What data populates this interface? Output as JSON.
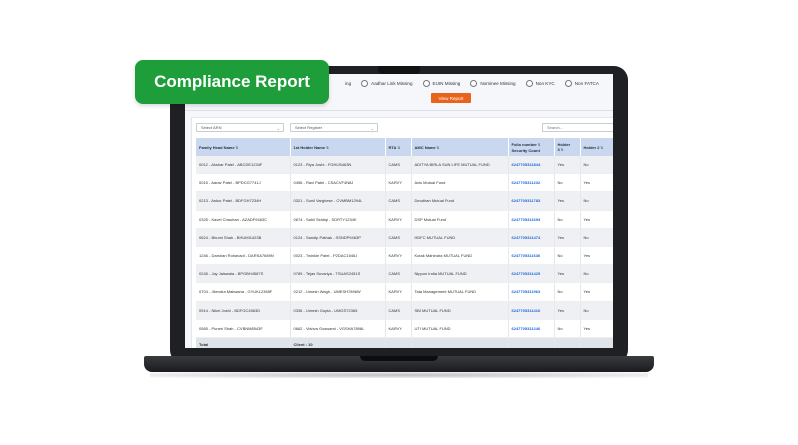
{
  "badge": {
    "label": "Compliance Report"
  },
  "filters": [
    {
      "label": "ing"
    },
    {
      "label": "Aadhar Link Missing"
    },
    {
      "label": "EUIN Missing"
    },
    {
      "label": "Nominee Missing"
    },
    {
      "label": "Non KYC"
    },
    {
      "label": "Non FATCA"
    }
  ],
  "view_button": {
    "label": "View Report"
  },
  "controls": {
    "arn_select": "Select ARN",
    "register_select": "Select Register",
    "search_placeholder": "Search..."
  },
  "table": {
    "headers": {
      "family_head": "Family Head Name",
      "first_holder": "1st Holder Name",
      "rta": "RTA",
      "amc": "AMC Name",
      "folio": "Folio number",
      "folio_sub": "Security Count",
      "holder3": "Holder 3",
      "holder2": "Holder 2"
    },
    "rows": [
      {
        "family_head": "0012 - Akshar Patel - ABCDE1234F",
        "first_holder": "0123 - Riya Joshi - FGHIJ5463N",
        "rta": "CAMS",
        "amc": "ADITYA BIRLA SUN LIFE MUTUAL FUND",
        "folio": "6247705311844",
        "h3": "Yes",
        "h2": "No"
      },
      {
        "family_head": "0015 - Aarav Patel - BPDCG7741J",
        "first_holder": "0456 - Ravi Patel - CSACVF4N8J",
        "rta": "KARVY",
        "amc": "Axis Mutual Fund",
        "folio": "6247705311232",
        "h3": "No",
        "h2": "Yes"
      },
      {
        "family_head": "0213 - Ankur Patel - BDFGH7234H",
        "first_holder": "0321 - Sunil Varghese - CVMBM1294L",
        "rta": "CAMS",
        "amc": "Deodhan Mutual Fund",
        "folio": "6247705311783",
        "h3": "Yes",
        "h2": "No"
      },
      {
        "family_head": "0325 - Kavel Chauhan - AZADF9463C",
        "first_holder": "0674 - Sahil Siddiqi - SDRTY1234K",
        "rta": "KARVY",
        "amc": "DSP Mutual Fund",
        "folio": "6247705311693",
        "h3": "No",
        "h2": "Yes"
      },
      {
        "family_head": "0624 - Bhumi Shah - BHUMI1423B",
        "first_holder": "0124 - Sandip Pathak - SSNDP9463P",
        "rta": "CAMS",
        "amc": "HDFC MUTUAL FUND",
        "folio": "6247705311474",
        "h3": "Yes",
        "h2": "No"
      },
      {
        "family_head": "1246 - Darshan Rohavadi - DARSA7689N",
        "first_holder": "0023 - Twinkle Patel - P2DAC1546J",
        "rta": "KARVY",
        "amc": "Kotak Mahindra MUTUAL FUND",
        "folio": "6247705311636",
        "h3": "No",
        "h2": "Yes"
      },
      {
        "family_head": "0245 - Jay Jaiswala - BPGBH4587S",
        "first_holder": "0789 - Tejas Suvariya - TSUAS2451S",
        "rta": "CAMS",
        "amc": "Nippon India MUTUAL FUND",
        "folio": "6247705311425",
        "h3": "Yes",
        "h2": "No"
      },
      {
        "family_head": "0704 - Jitendra Makwana - GYUKL2365F",
        "first_holder": "0212 - Umesh Wagh - UMESH7896W",
        "rta": "KARVY",
        "amc": "Tata Management MUTUAL FUND",
        "folio": "6247705311963",
        "h3": "No",
        "h2": "Yes"
      },
      {
        "family_head": "0914 - Nikel Joshi - BDFGC4563D",
        "first_holder": "0336 - Umesh Gupta - UMGS72365",
        "rta": "CAMS",
        "amc": "SBI MUTUAL FUND",
        "folio": "6247705311416",
        "h3": "Yes",
        "h2": "No"
      },
      {
        "family_head": "0565 - Puneri Shah - CVBNM8543F",
        "first_holder": "0662 - Vishva Goswami - VGSHA7896L",
        "rta": "KARVY",
        "amc": "UTI MUTUAL FUND",
        "folio": "6247705311246",
        "h3": "No",
        "h2": "Yes"
      }
    ],
    "total": {
      "label": "Total",
      "count": "Client : 10"
    }
  }
}
